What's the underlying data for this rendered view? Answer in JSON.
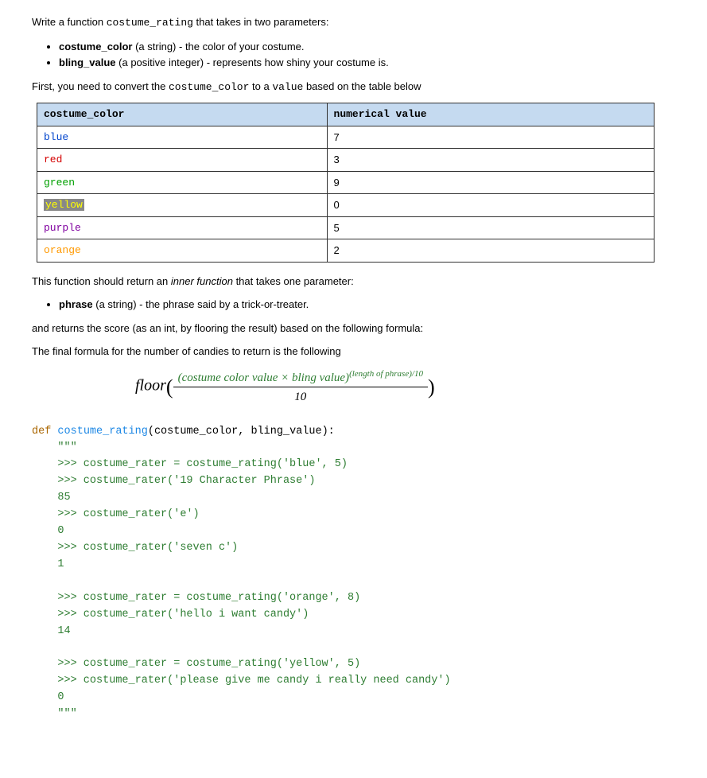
{
  "intro": {
    "line1_pre": "Write a function ",
    "line1_code": "costume_rating",
    "line1_post": " that takes in two parameters:",
    "bullet1_bold": "costume_color",
    "bullet1_rest": " (a string) - the color of your costume.",
    "bullet2_bold": "bling_value",
    "bullet2_rest": " (a positive integer) - represents how shiny your costume is."
  },
  "convert": {
    "pre": "First, you need to convert the ",
    "code1": "costume_color",
    "mid": " to a ",
    "code2": "value",
    "post": "  based on the table below"
  },
  "table": {
    "headers": [
      "costume_color",
      "numerical value"
    ],
    "rows": [
      {
        "name": "blue",
        "cls": "c-blue",
        "val": "7"
      },
      {
        "name": "red",
        "cls": "c-red",
        "val": "3"
      },
      {
        "name": "green",
        "cls": "c-green",
        "val": "9"
      },
      {
        "name": "yellow",
        "cls": "c-yellow",
        "val": "0"
      },
      {
        "name": "purple",
        "cls": "c-purple",
        "val": "5"
      },
      {
        "name": "orange",
        "cls": "c-orange",
        "val": "2"
      }
    ]
  },
  "inner": {
    "line1_pre": "This function should return an ",
    "line1_em": "inner function",
    "line1_post": " that takes one parameter:",
    "bullet_bold": "phrase",
    "bullet_rest": " (a string) - the phrase said by a trick-or-treater.",
    "returns": "and returns the score (as an int, by flooring the result) based on the following formula:",
    "final": "The final formula for the number of candies to return is the following"
  },
  "formula": {
    "floor": "floor",
    "num_text": "(costume color value × bling value)",
    "exp_text": "(length of phrase)/10",
    "den": "10"
  },
  "code": {
    "def_kw": "def",
    "def_name": "costume_rating",
    "def_params": "(costume_color, bling_value):",
    "docopen": "\"\"\"",
    "l1": ">>> costume_rater = costume_rating('blue', 5)",
    "l2": ">>> costume_rater('19 Character Phrase')",
    "r1": "85",
    "l3": ">>> costume_rater('e')",
    "r2": "0",
    "l4": ">>> costume_rater('seven c')",
    "r3": "1",
    "l5": ">>> costume_rater = costume_rating('orange', 8)",
    "l6": ">>> costume_rater('hello i want candy')",
    "r4": "14",
    "l7": ">>> costume_rater = costume_rating('yellow', 5)",
    "l8": ">>> costume_rater('please give me candy i really need candy')",
    "r5": "0",
    "docclose": "\"\"\""
  }
}
